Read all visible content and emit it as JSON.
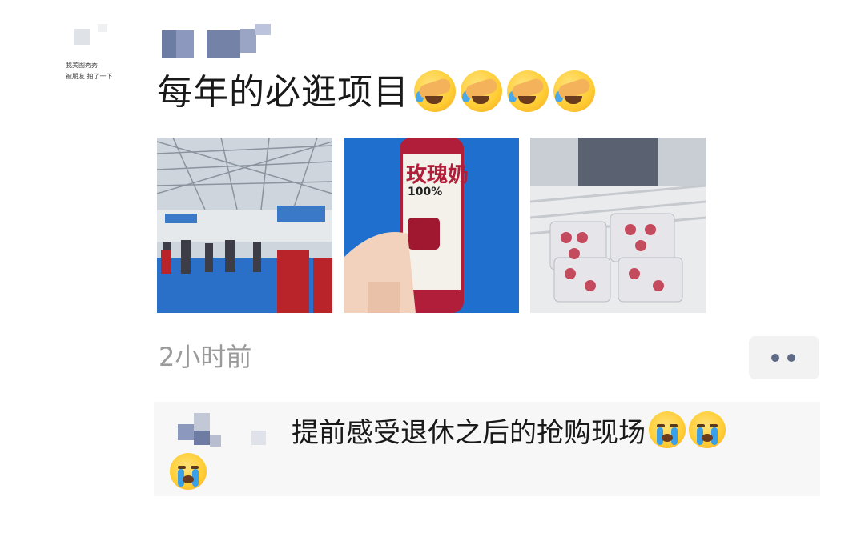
{
  "post": {
    "avatar_caption_line1": "我美图秀秀",
    "avatar_caption_line2": "被朋友 拍了一下",
    "text": "每年的必逛项目",
    "emoji_names": [
      "facepalm-cry-emoji",
      "facepalm-cry-emoji",
      "facepalm-cry-emoji",
      "facepalm-cry-emoji"
    ],
    "photos": [
      {
        "name": "exhibition-hall-photo"
      },
      {
        "name": "rose-drink-bottle-photo",
        "bottle_label": "玫瑰奶",
        "bottle_sub": "100%"
      },
      {
        "name": "produce-crate-photo"
      }
    ],
    "time": "2小时前",
    "more_icon": "more-dots-icon"
  },
  "comment": {
    "text": "提前感受退休之后的抢购现场",
    "emoji_name": "loudly-crying-emoji"
  },
  "colors": {
    "accent_dots": "#5f6b86",
    "time": "#9a9a9a"
  }
}
